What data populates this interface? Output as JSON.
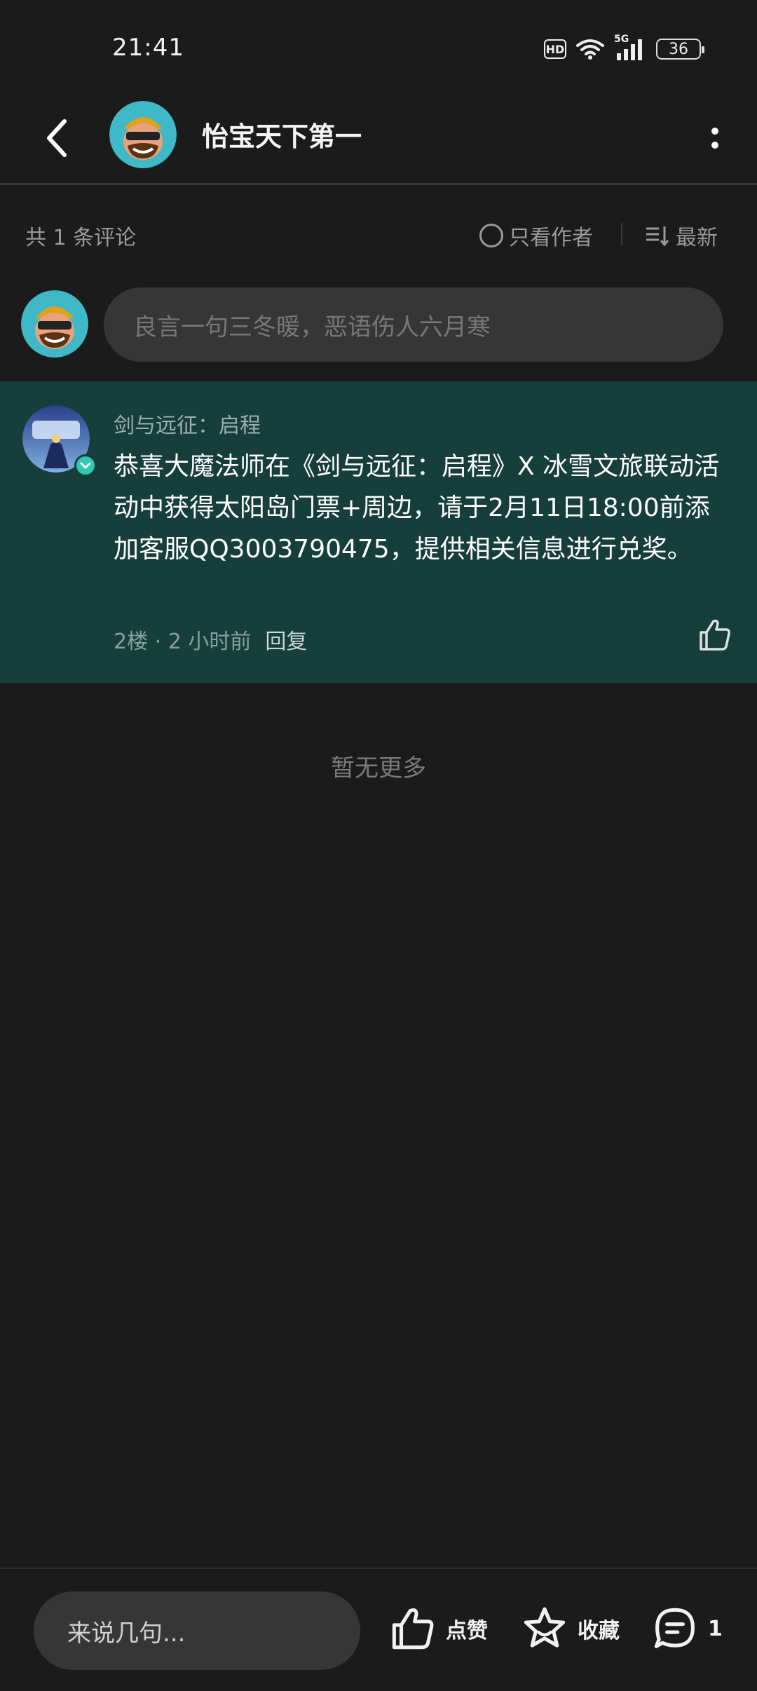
{
  "status_bar": {
    "time": "21:41",
    "hd_label": "HD",
    "network_label": "5G",
    "battery_level": "36"
  },
  "header": {
    "title": "怡宝天下第一",
    "back_icon": "chevron-left-icon",
    "more_icon": "more-vertical-icon"
  },
  "comments_meta": {
    "count_label": "共 1 条评论",
    "author_only_label": "只看作者",
    "sort_label": "最新"
  },
  "comment_input": {
    "placeholder": "良言一句三冬暖，恶语伤人六月寒"
  },
  "comments": [
    {
      "author": "剑与远征：启程",
      "text": "恭喜大魔法师在《剑与远征：启程》X 冰雪文旅联动活动中获得太阳岛门票+周边，请于2月11日18:00前添加客服QQ3003790475，提供相关信息进行兑奖。",
      "floor_time": "2楼 · 2 小时前",
      "reply_label": "回复"
    }
  ],
  "no_more_label": "暂无更多",
  "bottom_bar": {
    "input_placeholder": "来说几句...",
    "like_label": "点赞",
    "favorite_label": "收藏",
    "comment_count": "1"
  },
  "colors": {
    "background": "#1b1b1b",
    "comment_highlight": "#163e3a",
    "verified_accent": "#2fc9b1"
  }
}
